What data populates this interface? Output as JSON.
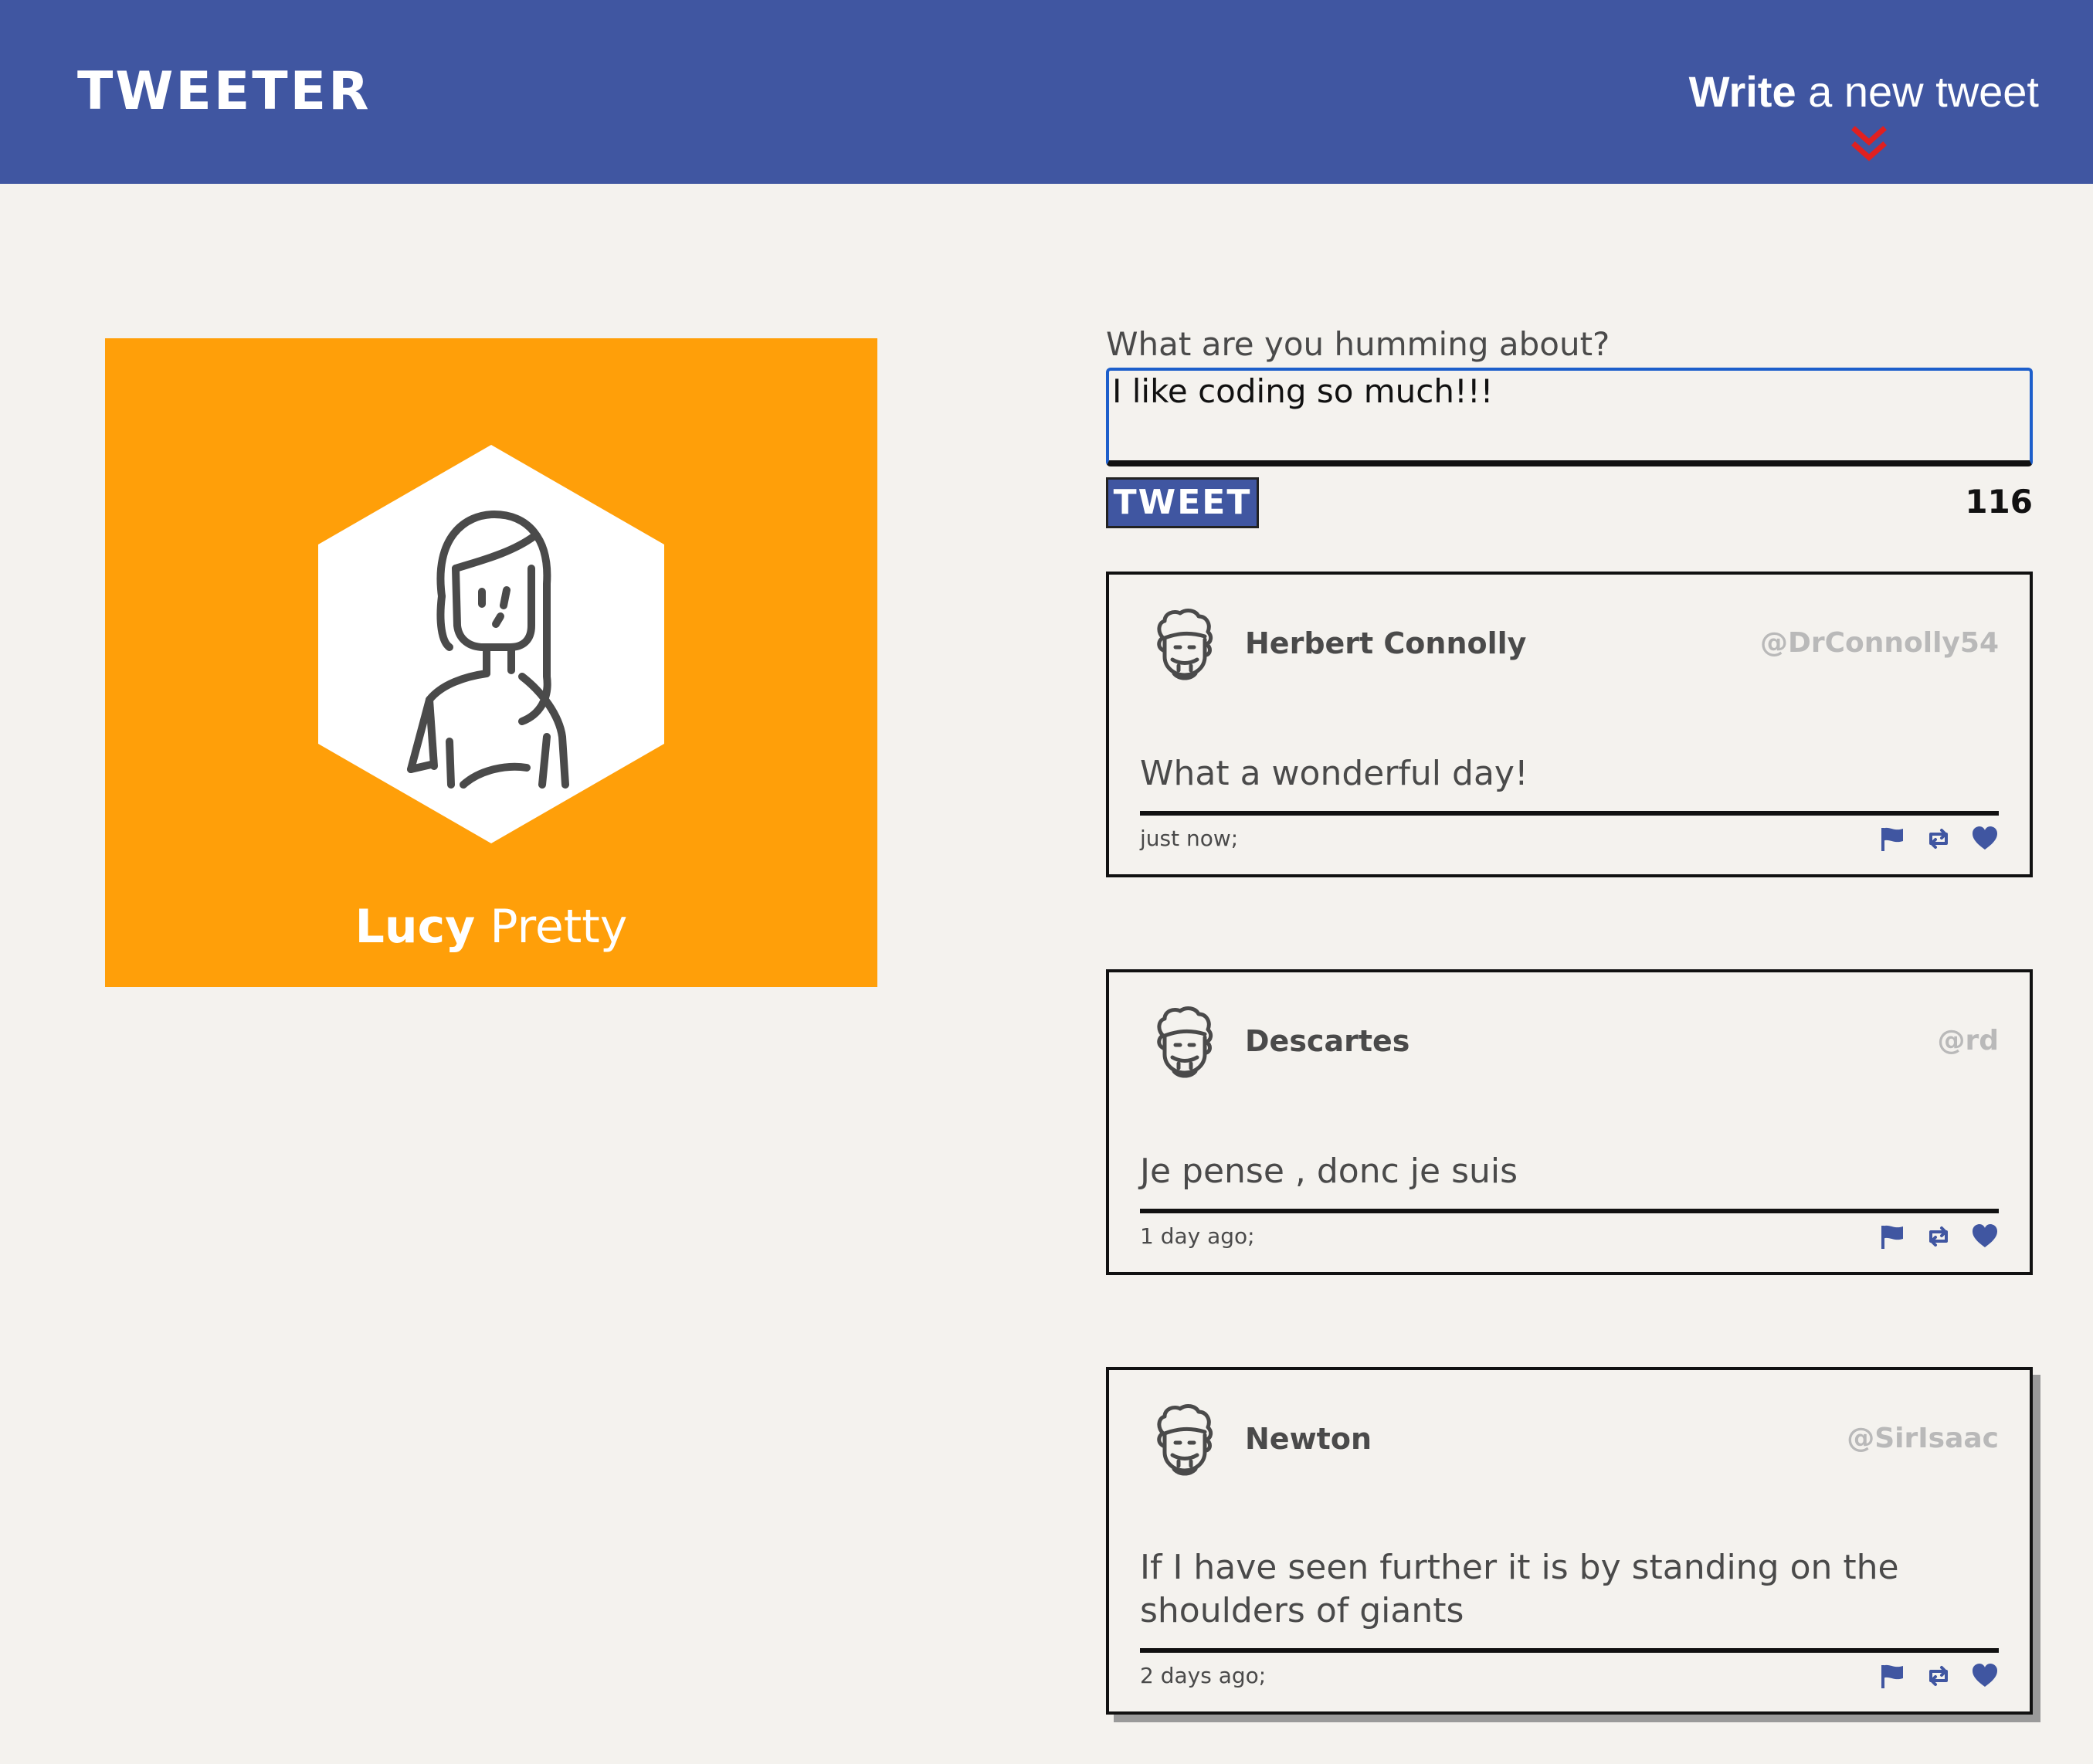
{
  "nav": {
    "brand": "TWEETER",
    "compose_strong": "Write",
    "compose_rest": " a new tweet",
    "chevron_icon": "double-chevron-down-icon",
    "colors": {
      "bar": "#4056a1",
      "chevron": "#e02020"
    }
  },
  "profile": {
    "first_name": "Lucy",
    "last_name": "Pretty",
    "avatar_icon": "female-avatar-icon",
    "background": "#ff9f09"
  },
  "compose": {
    "label": "What are you humming about?",
    "text": "I like coding so much!!!",
    "button_label": "TWEET",
    "counter": "116"
  },
  "tweets": [
    {
      "name": "Herbert Connolly",
      "handle": "@DrConnolly54",
      "text": "What a wonderful day!",
      "time": "just now;",
      "avatar_icon": "male-avatar-icon"
    },
    {
      "name": "Descartes",
      "handle": "@rd",
      "text": "Je pense , donc je suis",
      "time": "1 day ago;",
      "avatar_icon": "male-avatar-icon"
    },
    {
      "name": "Newton",
      "handle": "@SirIsaac",
      "text": "If I have seen further it is by standing on the shoulders of giants",
      "time": "2 days ago;",
      "avatar_icon": "male-avatar-icon"
    }
  ],
  "action_icons": [
    "flag-icon",
    "retweet-icon",
    "heart-icon"
  ],
  "action_color": "#4056a1"
}
